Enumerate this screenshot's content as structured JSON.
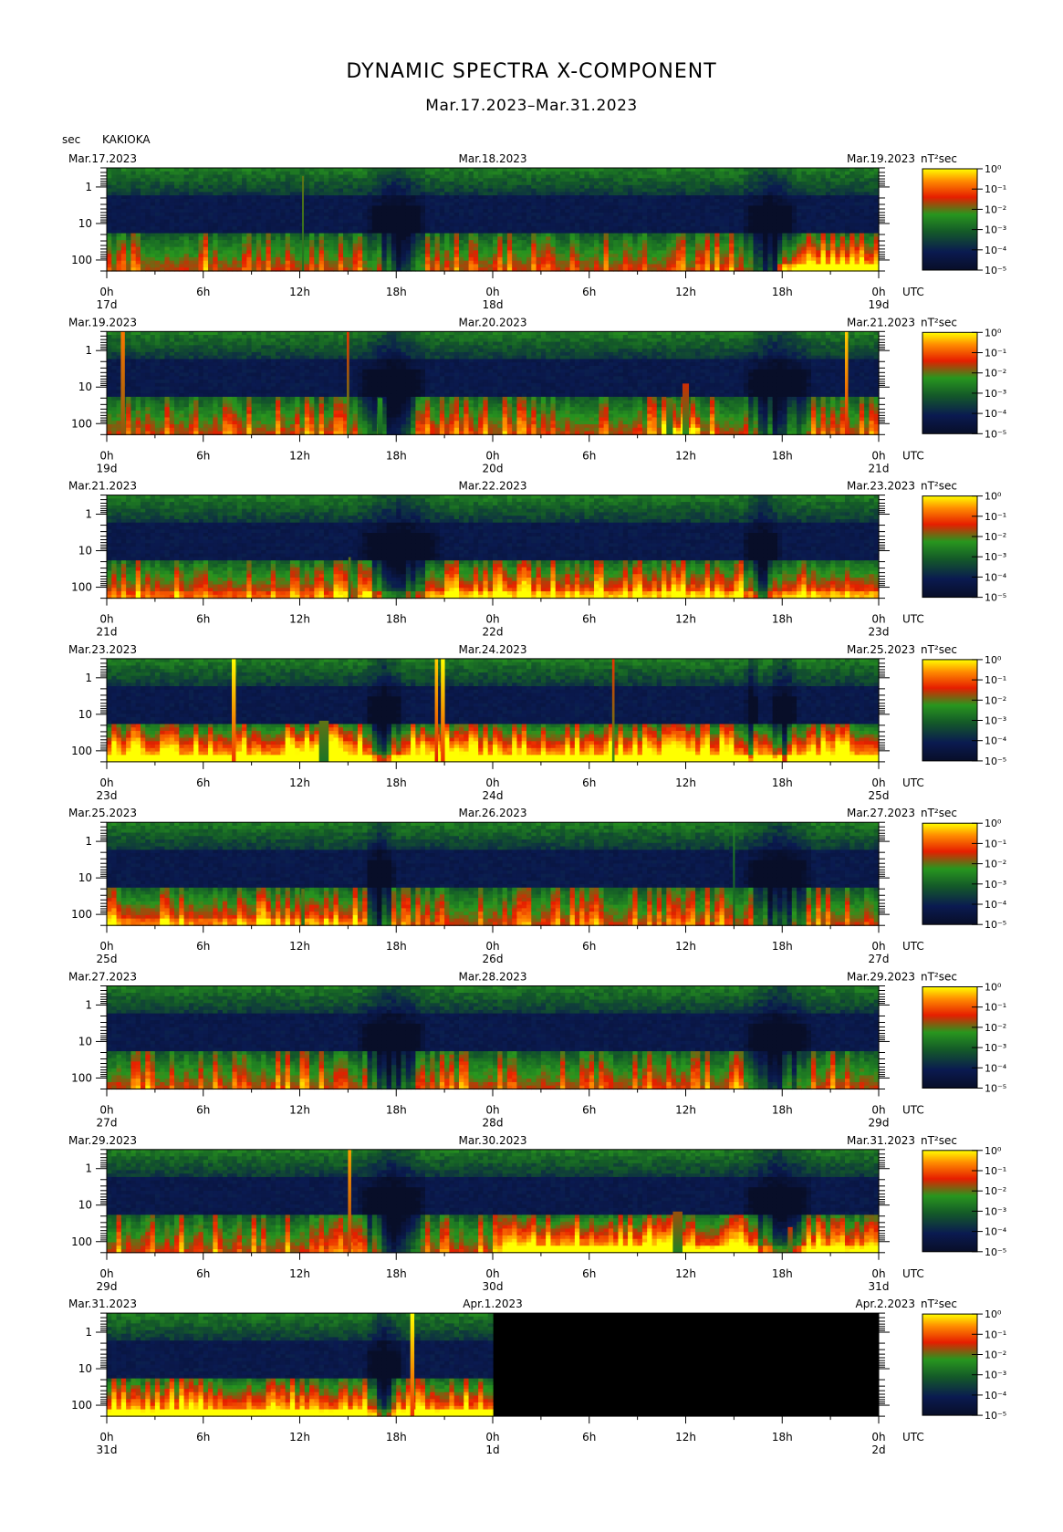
{
  "title": "DYNAMIC SPECTRA X-COMPONENT",
  "subtitle": "Mar.17.2023–Mar.31.2023",
  "y_unit": "sec",
  "station": "KAKIOKA",
  "utc_label": "UTC",
  "cbar_unit": "nT²sec",
  "colors": {
    "background": "#000000",
    "low": "#0a1a3c",
    "mid": "#1f8c1f",
    "high": "#ff2a00",
    "top": "#ffff00"
  },
  "chart_data": {
    "type": "heatmap",
    "x_ticks": [
      "0h",
      "6h",
      "12h",
      "18h",
      "0h",
      "6h",
      "12h",
      "18h",
      "0h"
    ],
    "y_ticks": [
      "1",
      "10",
      "100"
    ],
    "y_tick_values": [
      1,
      10,
      100
    ],
    "ylim": [
      0.3,
      200
    ],
    "y_scale": "log",
    "x_unit": "hours",
    "xlim": [
      0,
      48
    ],
    "colorbar_ticks": [
      "10⁰",
      "10⁻¹",
      "10⁻²",
      "10⁻³",
      "10⁻⁴",
      "10⁻⁵"
    ],
    "colorbar_range": [
      1e-05,
      1
    ],
    "panels": [
      {
        "start": "Mar.17.2023",
        "mid": "Mar.18.2023",
        "end": "Mar.19.2023",
        "day_start": "17d",
        "day_mid": "18d",
        "day_end": "19d",
        "spikes": [
          {
            "t": 12.2,
            "top": 0.5,
            "intensity": 0.6,
            "w": 0.1
          }
        ],
        "quiet": [
          [
            16.0,
            20.0
          ],
          [
            39.5,
            43.0
          ]
        ],
        "storm": [
          [
            41.8,
            48,
            0.5
          ]
        ]
      },
      {
        "start": "Mar.19.2023",
        "mid": "Mar.20.2023",
        "end": "Mar.21.2023",
        "day_start": "19d",
        "day_mid": "20d",
        "day_end": "21d",
        "spikes": [
          {
            "t": 1.0,
            "top": 0.3,
            "intensity": 0.85,
            "w": 0.25
          },
          {
            "t": 15.0,
            "top": 0.3,
            "intensity": 0.75,
            "w": 0.15
          },
          {
            "t": 46.0,
            "top": 0.3,
            "intensity": 0.95,
            "w": 0.2
          },
          {
            "t": 36.0,
            "top": 8,
            "intensity": 0.7,
            "w": 0.4
          },
          {
            "t": 35.0,
            "top": 20,
            "intensity": 0.6,
            "w": 0.4
          },
          {
            "t": 17.0,
            "top": 20,
            "intensity": 0.55,
            "w": 0.3
          }
        ],
        "quiet": [
          [
            15.5,
            20.0
          ],
          [
            39.5,
            44.0
          ]
        ],
        "storm": [
          [
            34.5,
            37,
            0.35
          ]
        ]
      },
      {
        "start": "Mar.21.2023",
        "mid": "Mar.22.2023",
        "end": "Mar.23.2023",
        "day_start": "21d",
        "day_mid": "22d",
        "day_end": "23d",
        "spikes": [
          {
            "t": 15.1,
            "top": 15,
            "intensity": 0.6,
            "w": 0.15
          }
        ],
        "quiet": [
          [
            15.5,
            21.0
          ],
          [
            39.5,
            42.0
          ]
        ],
        "storm": [
          [
            16,
            48,
            0.3
          ],
          [
            0,
            15,
            0.15
          ]
        ]
      },
      {
        "start": "Mar.23.2023",
        "mid": "Mar.24.2023",
        "end": "Mar.25.2023",
        "day_start": "23d",
        "day_mid": "24d",
        "day_end": "25d",
        "spikes": [
          {
            "t": 7.9,
            "top": 0.3,
            "intensity": 1.0,
            "w": 0.25
          },
          {
            "t": 20.5,
            "top": 0.3,
            "intensity": 0.95,
            "w": 0.2
          },
          {
            "t": 20.9,
            "top": 0.3,
            "intensity": 1.0,
            "w": 0.25
          },
          {
            "t": 31.5,
            "top": 0.3,
            "intensity": 0.75,
            "w": 0.15
          },
          {
            "t": 13.5,
            "top": 15,
            "intensity": 0.6,
            "w": 0.6
          }
        ],
        "quiet": [
          [
            16.0,
            18.5
          ],
          [
            39.7,
            40.5
          ],
          [
            41.2,
            43.0
          ]
        ],
        "storm": [
          [
            0,
            48,
            0.6
          ],
          [
            11,
            15,
            0.95
          ],
          [
            19,
            22,
            0.85
          ]
        ]
      },
      {
        "start": "Mar.25.2023",
        "mid": "Mar.26.2023",
        "end": "Mar.27.2023",
        "day_start": "25d",
        "day_mid": "26d",
        "day_end": "27d",
        "spikes": [
          {
            "t": 39.0,
            "top": 0.3,
            "intensity": 0.5,
            "w": 0.1
          },
          {
            "t": 12.2,
            "top": 20,
            "intensity": 0.6,
            "w": 0.2
          }
        ],
        "quiet": [
          [
            16.0,
            18.0
          ],
          [
            39.5,
            44.0
          ]
        ],
        "storm": [
          [
            0,
            16,
            0.2
          ]
        ]
      },
      {
        "start": "Mar.27.2023",
        "mid": "Mar.28.2023",
        "end": "Mar.29.2023",
        "day_start": "27d",
        "day_mid": "28d",
        "day_end": "29d",
        "spikes": [],
        "quiet": [
          [
            15.5,
            20.0
          ],
          [
            39.5,
            44.0
          ]
        ],
        "storm": []
      },
      {
        "start": "Mar.29.2023",
        "mid": "Mar.30.2023",
        "end": "Mar.31.2023",
        "day_start": "29d",
        "day_mid": "30d",
        "day_end": "31d",
        "spikes": [
          {
            "t": 15.1,
            "top": 0.3,
            "intensity": 0.9,
            "w": 0.2
          },
          {
            "t": 35.5,
            "top": 15,
            "intensity": 0.65,
            "w": 0.6
          },
          {
            "t": 42.5,
            "top": 40,
            "intensity": 0.7,
            "w": 0.3
          }
        ],
        "quiet": [
          [
            15.5,
            20.0
          ],
          [
            39.5,
            44.0
          ]
        ],
        "storm": [
          [
            24.5,
            36,
            0.55
          ],
          [
            36,
            48,
            0.4
          ]
        ]
      },
      {
        "start": "Mar.31.2023",
        "mid": "Apr.1.2023",
        "end": "Apr.2.2023",
        "day_start": "31d",
        "day_mid": "1d",
        "day_end": "2d",
        "spikes": [
          {
            "t": 19.0,
            "top": 0.3,
            "intensity": 1.0,
            "w": 0.25
          }
        ],
        "quiet": [
          [
            16.0,
            18.5
          ]
        ],
        "storm": [
          [
            0,
            24,
            0.45
          ]
        ],
        "data_end": 24
      }
    ]
  }
}
